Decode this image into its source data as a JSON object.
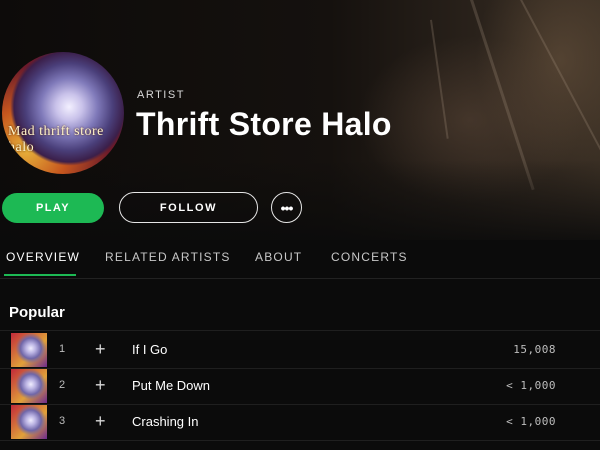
{
  "header": {
    "type_label": "ARTIST",
    "artist_name": "Thrift Store Halo",
    "avatar_text": "Mad thrift store halo"
  },
  "actions": {
    "play_label": "PLAY",
    "follow_label": "FOLLOW",
    "more_label": "•••"
  },
  "tabs": [
    {
      "label": "OVERVIEW",
      "active": true
    },
    {
      "label": "RELATED ARTISTS",
      "active": false
    },
    {
      "label": "ABOUT",
      "active": false
    },
    {
      "label": "CONCERTS",
      "active": false
    }
  ],
  "popular": {
    "title": "Popular",
    "add_glyph": "+",
    "tracks": [
      {
        "number": "1",
        "title": "If I Go",
        "plays": "15,008"
      },
      {
        "number": "2",
        "title": "Put Me Down",
        "plays": "< 1,000"
      },
      {
        "number": "3",
        "title": "Crashing In",
        "plays": "< 1,000"
      }
    ]
  },
  "colors": {
    "accent": "#1db954",
    "background": "#0b0b0b"
  },
  "icons": {
    "add": "plus-icon",
    "more": "ellipsis-icon"
  }
}
